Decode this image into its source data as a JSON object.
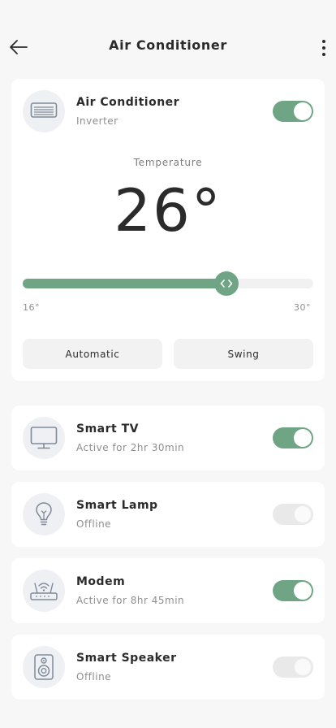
{
  "header": {
    "title": "Air Conditioner",
    "back_icon": "arrow-left-icon",
    "more_icon": "more-vertical-icon"
  },
  "ac": {
    "name": "Air Conditioner",
    "subtitle": "Inverter",
    "icon": "air-conditioner-icon",
    "power_on": true,
    "temperature_label": "Temperature",
    "temperature": "26°",
    "temperature_value": 26,
    "min_label": "16°",
    "max_label": "30°",
    "min": 16,
    "max": 30,
    "slider_level": 0.7,
    "modes": [
      "Automatic",
      "Swing"
    ]
  },
  "devices": [
    {
      "name": "Smart TV",
      "status": "Active for 2hr 30min",
      "icon": "tv-icon",
      "on": true
    },
    {
      "name": "Smart Lamp",
      "status": "Offline",
      "icon": "lamp-icon",
      "on": false
    },
    {
      "name": "Modem",
      "status": "Active for 8hr 45min",
      "icon": "router-icon",
      "on": true
    },
    {
      "name": "Smart Speaker",
      "status": "Offline",
      "icon": "speaker-icon",
      "on": false
    }
  ],
  "colors": {
    "accent": "#6fa584",
    "toggle_off": "#e9e9e9",
    "icon_bg": "#eef0f3",
    "icon_stroke": "#7f8a99"
  }
}
